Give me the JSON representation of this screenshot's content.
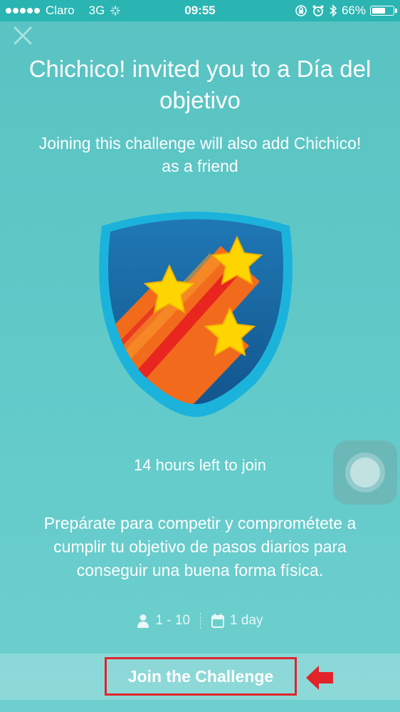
{
  "status_bar": {
    "carrier": "Claro",
    "network": "3G",
    "time": "09:55",
    "battery": "66%",
    "battery_fraction": 0.66
  },
  "header": {
    "close_icon": "close-icon"
  },
  "challenge": {
    "title": "Chichico! invited you to a Día del objetivo",
    "subtitle": "Joining this challenge will also add Chichico! as a friend",
    "badge_icon": "shooting-stars-shield-icon",
    "time_left": "14 hours left to join",
    "description": "Prepárate para competir y comprométete a cumplir tu objetivo de pasos diarios para conseguir una buena forma física.",
    "participants": "1 - 10",
    "duration": "1 day"
  },
  "actions": {
    "join_label": "Join the Challenge"
  },
  "colors": {
    "background": "#5fc6c5",
    "status_bar": "#2ab5b2",
    "highlight": "#e0242a"
  }
}
